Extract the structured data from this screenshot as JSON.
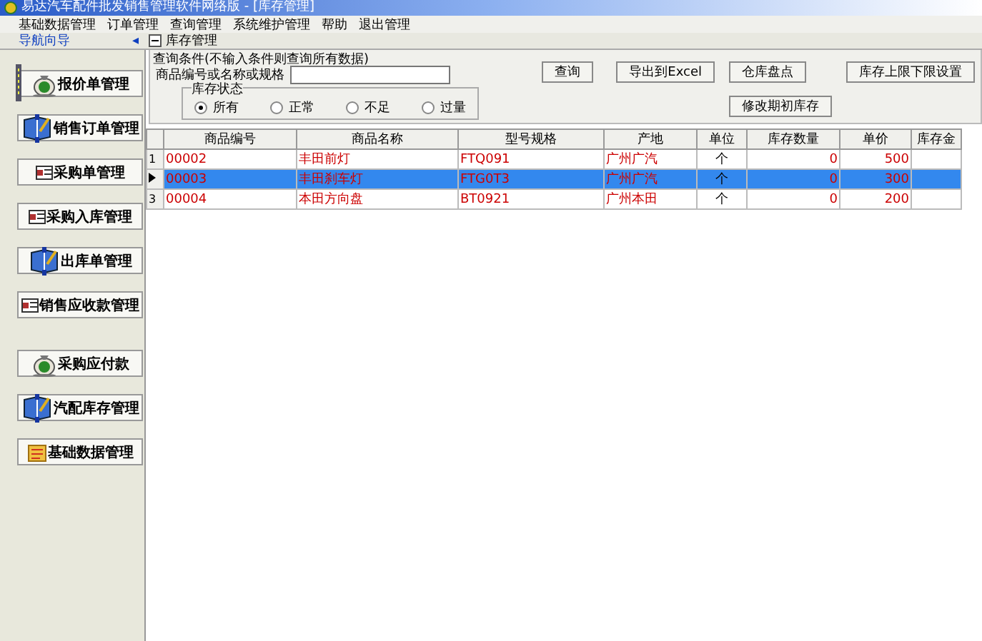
{
  "window": {
    "title": "易达汽车配件批发销售管理软件网络版 - [库存管理]"
  },
  "menu": [
    "基础数据管理",
    "订单管理",
    "查询管理",
    "系统维护管理",
    "帮助",
    "退出管理"
  ],
  "navigator": {
    "title": "导航向导",
    "collapse_glyph": "◂",
    "items": [
      {
        "label": "报价单管理",
        "kind": "bag"
      },
      {
        "label": "销售订单管理",
        "kind": "book"
      },
      {
        "label": "采购单管理",
        "kind": "card"
      },
      {
        "label": "采购入库管理",
        "kind": "card"
      },
      {
        "label": "出库单管理",
        "kind": "book"
      },
      {
        "label": "销售应收款管理",
        "kind": "card"
      },
      {
        "label": "采购应付款",
        "kind": "bag"
      },
      {
        "label": "汽配库存管理",
        "kind": "book"
      },
      {
        "label": "基础数据管理",
        "kind": "folder"
      }
    ]
  },
  "document_tab": {
    "title": "库存管理",
    "expanded": true
  },
  "query": {
    "title": "查询条件(不输入条件则查询所有数据)",
    "search_label": "商品编号或名称或规格",
    "status": {
      "title": "库存状态",
      "options": [
        {
          "label": "所有",
          "selected": true
        },
        {
          "label": "正常",
          "selected": false
        },
        {
          "label": "不足",
          "selected": false
        },
        {
          "label": "过量",
          "selected": false
        }
      ]
    },
    "buttons": [
      "查询",
      "导出到Excel",
      "仓库盘点",
      "库存上限下限设置",
      "修改期初库存"
    ]
  },
  "table": {
    "columns": [
      "商品编号",
      "商品名称",
      "型号规格",
      "产地",
      "单位",
      "库存数量",
      "单价",
      "库存金"
    ],
    "rows": [
      {
        "row_header": "1",
        "selected": false,
        "cells": [
          "00002",
          "丰田前灯",
          "FTQ091",
          "广州广汽",
          "个",
          "0",
          "500"
        ]
      },
      {
        "selected": true,
        "cells": [
          "00003",
          "丰田刹车灯",
          "FTG0T3",
          "广州广汽",
          "个",
          "0",
          "300"
        ]
      },
      {
        "row_header": "3",
        "selected": false,
        "cells": [
          "00004",
          "本田方向盘",
          "BT0921",
          "广州本田",
          "个",
          "0",
          "200"
        ]
      }
    ]
  }
}
